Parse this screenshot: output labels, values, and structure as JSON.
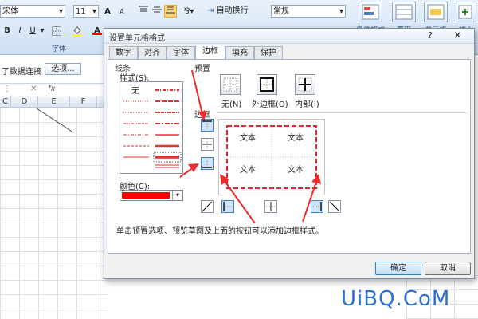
{
  "ribbon": {
    "font_name": "宋体",
    "font_size": "11",
    "font_group_label": "字体",
    "bold": "B",
    "italic": "I",
    "underline": "U",
    "underline_dd": "▾",
    "color_a": "A",
    "grow_font": "A",
    "shrink_font": "A",
    "wrap_text": "自动换行",
    "number_format": "常规",
    "cond_format": "条件格式",
    "table_style": "套用",
    "cell_style": "单元格",
    "insert": "插入"
  },
  "sheet": {
    "data_connection": "了数据连接",
    "options_button": "选项...",
    "fx": "fx",
    "columns": [
      "C",
      "D",
      "E",
      "F"
    ],
    "font_color_hex": "#ff0000"
  },
  "dialog": {
    "title": "设置单元格格式",
    "help": "?",
    "close": "×",
    "tabs": [
      "数字",
      "对齐",
      "字体",
      "边框",
      "填充",
      "保护"
    ],
    "active_tab": "边框",
    "line_group": "线条",
    "style_label": "样式(S):",
    "style_none": "无",
    "color_label": "颜色(C):",
    "line_color_hex": "#ff0000",
    "presets_label": "预置",
    "preset_none": "无(N)",
    "preset_outline": "外边框(O)",
    "preset_inside": "内部(I)",
    "border_label": "边框",
    "preview_text": [
      "文本",
      "文本",
      "文本",
      "文本"
    ],
    "hint": "单击预置选项、预览草图及上面的按钮可以添加边框样式。",
    "ok": "确定",
    "cancel": "取消"
  },
  "watermark": "UiBQ.CoM",
  "colors": {
    "accent_red": "#ee2c2c",
    "watermark_blue": "#2b6fd6",
    "ribbon_bg": "#dbe7f5",
    "selected_btn": "#fbd77c"
  }
}
